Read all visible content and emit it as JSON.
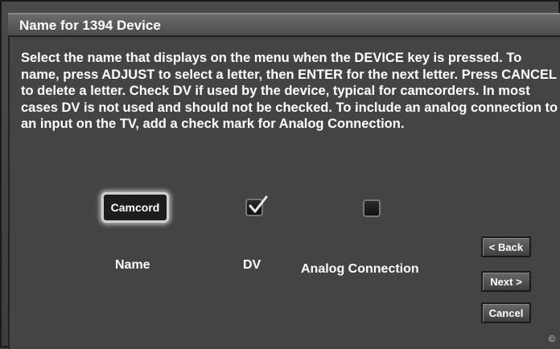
{
  "window": {
    "title": "Name for 1394 Device"
  },
  "instructions": "Select the name that displays on the menu when the DEVICE key is pressed.  To name, press ADJUST to select a letter, then ENTER for the next letter. Press CANCEL to delete a letter. Check DV if used by the device, typical for camcorders.  In most cases DV is not used and should not be checked.  To include an analog connection to an input on the TV, add a check mark for Analog Connection.",
  "name_button": {
    "value": "Camcord"
  },
  "dv_checkbox": {
    "checked": true,
    "icon": "checkmark-icon"
  },
  "analog_checkbox": {
    "checked": false
  },
  "labels": {
    "name": "Name",
    "dv": "DV",
    "analog": "Analog Connection"
  },
  "buttons": {
    "back": "< Back",
    "next": "Next >",
    "cancel": "Cancel"
  },
  "footer": {
    "copyright": "©"
  },
  "colors": {
    "background": "#3a3a3a",
    "titlebar": "#5a5a5a",
    "text": "#ffffff",
    "focus_glow": "#cfcfcf"
  }
}
